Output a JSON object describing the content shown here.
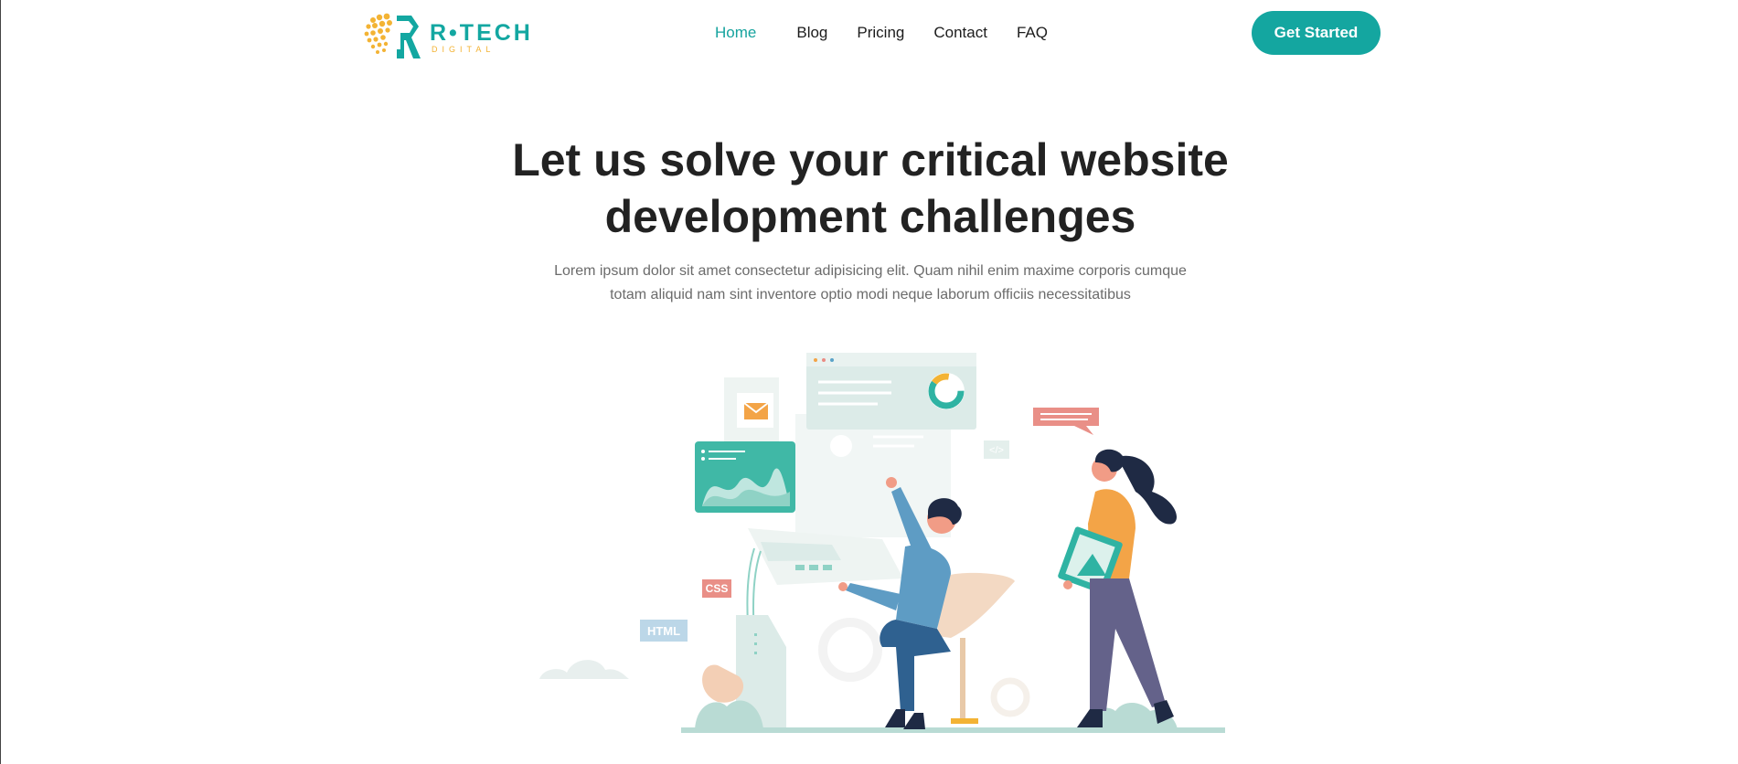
{
  "brand": {
    "name": "R•TECH",
    "tagline": "DIGITAL",
    "colors": {
      "teal": "#14a6a0",
      "gold": "#f3b334",
      "text": "#222222"
    }
  },
  "nav": {
    "items": [
      {
        "label": "Home",
        "active": true
      },
      {
        "label": "Blog",
        "active": false
      },
      {
        "label": "Pricing",
        "active": false
      },
      {
        "label": "Contact",
        "active": false
      },
      {
        "label": "FAQ",
        "active": false
      }
    ],
    "cta_label": "Get Started"
  },
  "hero": {
    "title_line1": "Let us solve your critical website",
    "title_line2": "development challenges",
    "subtitle_line1": "Lorem ipsum dolor sit amet consectetur adipisicing elit. Quam nihil enim maxime corporis cumque",
    "subtitle_line2": "totam aliquid nam sint inventore optio modi neque laborum officiis necessitatibus"
  },
  "illustration": {
    "tag_css": "CSS",
    "tag_html": "HTML",
    "tag_code": "</>"
  }
}
